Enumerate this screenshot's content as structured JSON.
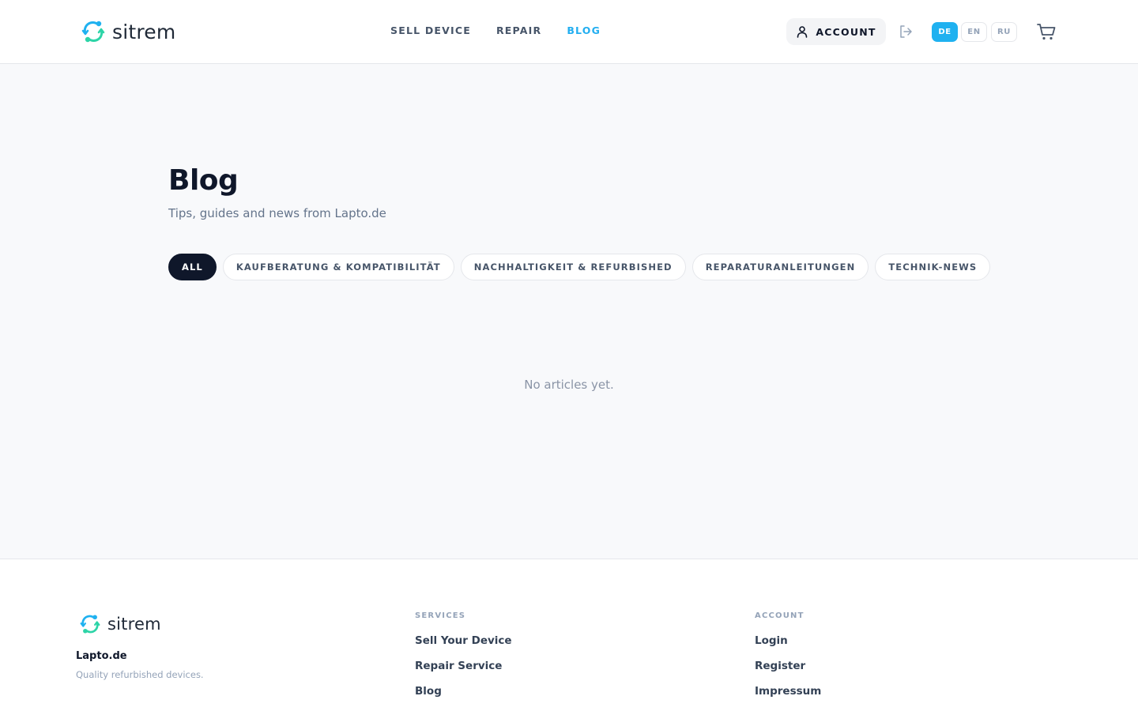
{
  "brand": {
    "logo_text": "sitrem",
    "accent_color": "#22aef0",
    "logo_colors": [
      "#1fb1f0",
      "#2dd4a7"
    ]
  },
  "header": {
    "nav": [
      {
        "label": "SELL DEVICE",
        "active": false
      },
      {
        "label": "REPAIR",
        "active": false
      },
      {
        "label": "BLOG",
        "active": true
      }
    ],
    "account_label": "ACCOUNT",
    "languages": [
      {
        "code": "DE",
        "selected": true
      },
      {
        "code": "EN",
        "selected": false
      },
      {
        "code": "RU",
        "selected": false
      }
    ],
    "icons": [
      "user-icon",
      "logout-icon",
      "cart-icon"
    ]
  },
  "main": {
    "title": "Blog",
    "subtitle": "Tips, guides and news from Lapto.de",
    "filters": [
      {
        "label": "ALL",
        "active": true
      },
      {
        "label": "KAUFBERATUNG & KOMPATIBILITÄT",
        "active": false
      },
      {
        "label": "NACHHALTIGKEIT & REFURBISHED",
        "active": false
      },
      {
        "label": "REPARATURANLEITUNGEN",
        "active": false
      },
      {
        "label": "TECHNIK-NEWS",
        "active": false
      }
    ],
    "empty_message": "No articles yet."
  },
  "footer": {
    "logo_text": "sitrem",
    "brand_name": "Lapto.de",
    "tagline": "Quality refurbished devices.",
    "services": {
      "heading": "SERVICES",
      "links": [
        "Sell Your Device",
        "Repair Service",
        "Blog"
      ]
    },
    "account": {
      "heading": "ACCOUNT",
      "links": [
        "Login",
        "Register",
        "Impressum"
      ]
    }
  }
}
